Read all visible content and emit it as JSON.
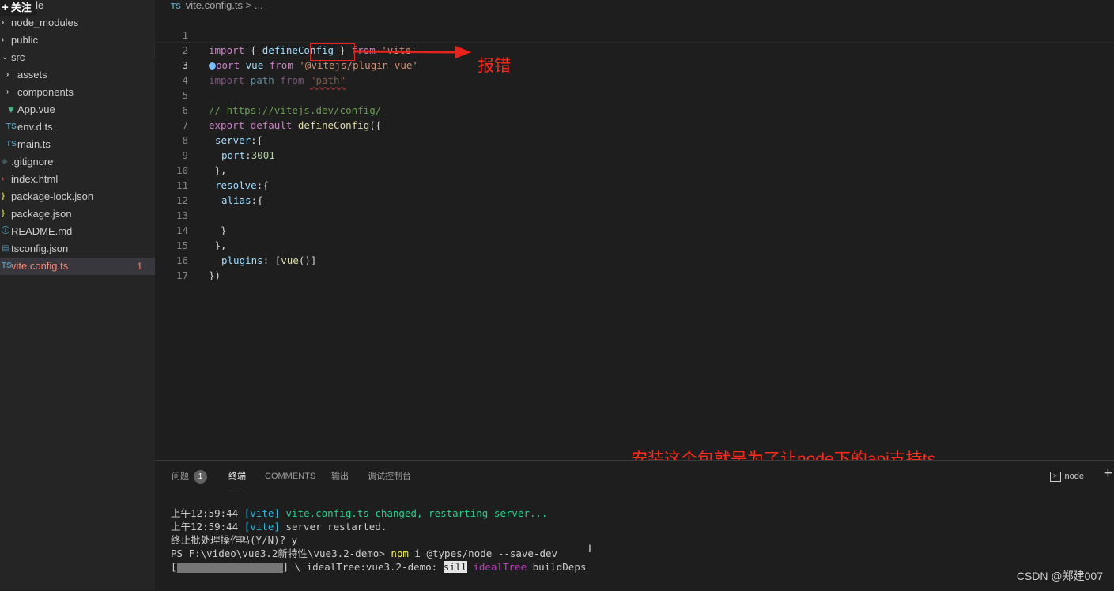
{
  "overlay": {
    "follow_label": "关注"
  },
  "explorer": {
    "items": [
      {
        "label": "vscode",
        "icon": "chevron-right-icon",
        "level": 0,
        "name": "folder-vscode"
      },
      {
        "label": "node_modules",
        "icon": "chevron-right-icon",
        "level": 0,
        "name": "folder-node-modules"
      },
      {
        "label": "public",
        "icon": "chevron-right-icon",
        "level": 0,
        "name": "folder-public"
      },
      {
        "label": "src",
        "icon": "chevron-down-icon",
        "level": 0,
        "name": "folder-src"
      },
      {
        "label": "assets",
        "icon": "chevron-right-icon",
        "level": 1,
        "name": "folder-assets"
      },
      {
        "label": "components",
        "icon": "chevron-right-icon",
        "level": 1,
        "name": "folder-components"
      },
      {
        "label": "App.vue",
        "icon": "vue-file-icon",
        "level": 1,
        "name": "file-app-vue"
      },
      {
        "label": "env.d.ts",
        "icon": "ts-file-icon",
        "level": 1,
        "name": "file-env-d-ts"
      },
      {
        "label": "main.ts",
        "icon": "ts-file-icon",
        "level": 1,
        "name": "file-main-ts"
      },
      {
        "label": ".gitignore",
        "icon": "git-file-icon",
        "level": 0,
        "name": "file-gitignore"
      },
      {
        "label": "index.html",
        "icon": "html-file-icon",
        "level": 0,
        "name": "file-index-html"
      },
      {
        "label": "package-lock.json",
        "icon": "json-file-icon",
        "level": 0,
        "name": "file-package-lock"
      },
      {
        "label": "package.json",
        "icon": "json-file-icon",
        "level": 0,
        "name": "file-package-json"
      },
      {
        "label": "README.md",
        "icon": "info-file-icon",
        "level": 0,
        "name": "file-readme"
      },
      {
        "label": "tsconfig.json",
        "icon": "tsconfig-file-icon",
        "level": 0,
        "name": "file-tsconfig"
      },
      {
        "label": "vite.config.ts",
        "icon": "ts-file-icon",
        "level": 0,
        "name": "file-vite-config",
        "active": true,
        "problems": "1"
      }
    ]
  },
  "editor": {
    "breadcrumb": {
      "file_icon": "TS",
      "file": "vite.config.ts",
      "separator": ">",
      "rest": "..."
    },
    "line_numbers": [
      "1",
      "2",
      "3",
      "4",
      "5",
      "6",
      "7",
      "8",
      "9",
      "10",
      "11",
      "12",
      "13",
      "14",
      "15",
      "16",
      "17"
    ],
    "lines": {
      "l1": {
        "a": "import",
        "b": " { ",
        "c": "defineConfig",
        "d": " } ",
        "e": "from",
        "f": " ",
        "g": "'vite'"
      },
      "l2": {
        "a": "port",
        "b": " ",
        "c": "vue",
        "d": " ",
        "e": "from",
        "f": " ",
        "g": "'@vitejs/plugin-vue'"
      },
      "l3": {
        "a": "import",
        "b": " path ",
        "c": "from",
        "d": " ",
        "e": "\"path\""
      },
      "l5": {
        "a": "// ",
        "b": "https://vitejs.dev/config/"
      },
      "l6": {
        "a": "export",
        "b": " ",
        "c": "default",
        "d": " ",
        "e": "defineConfig",
        "f": "({"
      },
      "l7": {
        "a": "server",
        "b": ":{"
      },
      "l8": {
        "a": "port",
        "b": ":",
        "c": "3001"
      },
      "l9": {
        "a": " },"
      },
      "l10": {
        "a": "resolve",
        "b": ":{"
      },
      "l11": {
        "a": "alias",
        "b": ":{"
      },
      "l13": {
        "a": "  }"
      },
      "l14": {
        "a": " },"
      },
      "l15": {
        "a": "plugins",
        "b": ": [",
        "c": "vue",
        "d": "()]"
      },
      "l16": {
        "a": "})"
      }
    }
  },
  "annotations": {
    "error_label": "报错",
    "install_note": "安装这个包就是为了让node下的api支持ts"
  },
  "panel": {
    "tabs": {
      "problems": "问题",
      "problems_count": "1",
      "terminal": "终端",
      "comments": "COMMENTS",
      "output": "输出",
      "debug_console": "调试控制台"
    },
    "terminal_name": "node",
    "terminal_lines": {
      "t1": {
        "time": "上午12:59:44",
        "tag": "[vite]",
        "msg": "vite.config.ts changed, restarting server..."
      },
      "t2": {
        "time": "上午12:59:44",
        "tag": "[vite]",
        "msg": "server restarted."
      },
      "t3": {
        "text": "终止批处理操作吗(Y/N)? y"
      },
      "t4": {
        "prompt": "PS F:\\video\\vue3.2新特性\\vue3.2-demo> ",
        "cmd_bin": "npm",
        "cmd_rest": " i @types/node --save-dev"
      },
      "t5": {
        "open": "[",
        "close": "] \\ idealTree:vue3.2-demo: ",
        "sill": "sill",
        "tree": " idealTree",
        "deps": " buildDeps"
      }
    }
  },
  "watermark": "CSDN @郑建007",
  "colors": {
    "editor_bg": "#1e1e1e",
    "sidebar_bg": "#252526",
    "keyword": "#c586c0",
    "string": "#ce9178",
    "annotation_red": "#ff2a1a"
  }
}
